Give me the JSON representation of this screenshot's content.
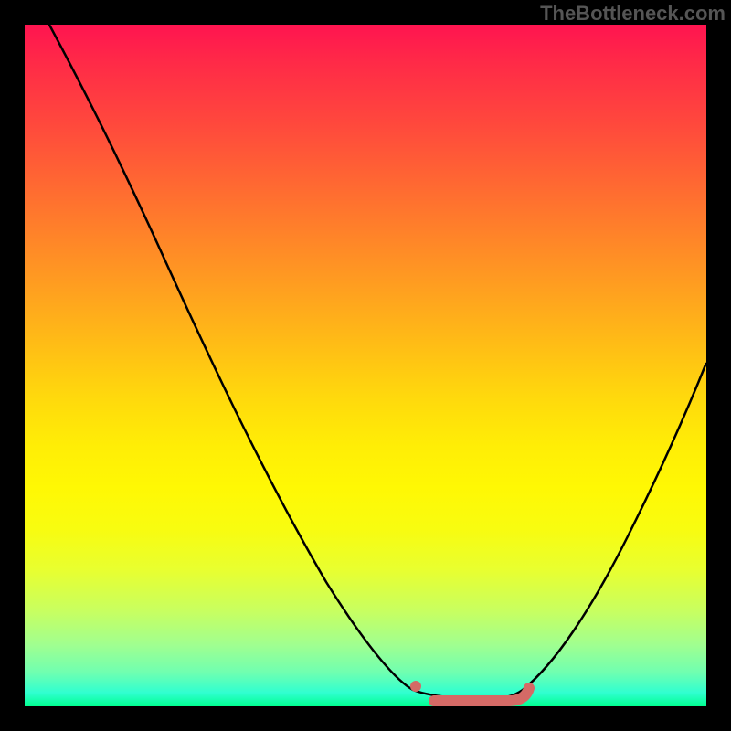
{
  "watermark": "TheBottleneck.com",
  "chart_data": {
    "type": "line",
    "title": "",
    "xlabel": "",
    "ylabel": "",
    "xlim": [
      0,
      100
    ],
    "ylim": [
      0,
      100
    ],
    "description": "Bottleneck-style curve on rainbow gradient (red=high bottleneck, green=optimal). Black V-curve with optimal flat region around x 57-72.",
    "gradient_stops": [
      {
        "pos": 0,
        "color": "#ff1450"
      },
      {
        "pos": 50,
        "color": "#ffda0c"
      },
      {
        "pos": 100,
        "color": "#00ff90"
      }
    ],
    "series": [
      {
        "name": "bottleneck-curve",
        "color": "#000000",
        "x": [
          0,
          2,
          6,
          12,
          20,
          30,
          40,
          50,
          55,
          57,
          60,
          65,
          70,
          72,
          76,
          82,
          90,
          100
        ],
        "y": [
          120,
          100,
          90,
          78,
          62,
          44,
          28,
          12,
          5,
          2,
          1,
          1,
          1,
          2,
          6,
          14,
          28,
          50
        ]
      }
    ],
    "optimal_marker": {
      "color": "#d56a66",
      "dot": {
        "x": 57,
        "y": 2.5
      },
      "band": {
        "x_start": 60,
        "x_end": 72,
        "y": 0.8
      }
    }
  }
}
